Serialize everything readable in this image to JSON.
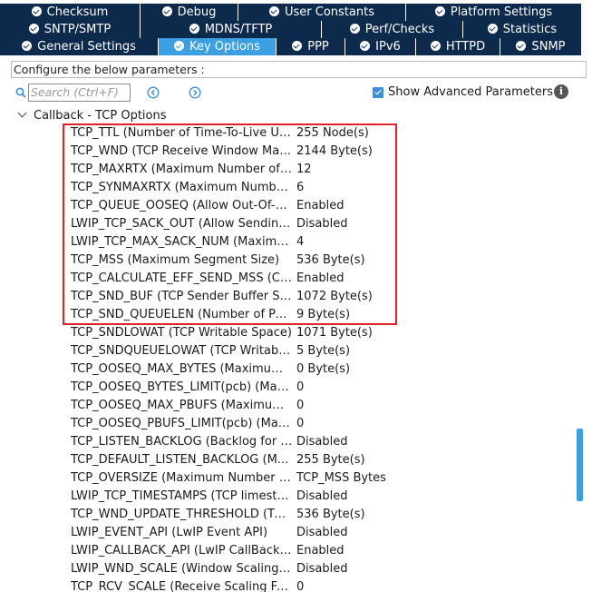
{
  "tabs": {
    "row1": [
      {
        "label": "Checksum"
      },
      {
        "label": "Debug"
      },
      {
        "label": "User Constants"
      },
      {
        "label": "Platform Settings"
      }
    ],
    "row2": [
      {
        "label": "SNTP/SMTP"
      },
      {
        "label": "MDNS/TFTP"
      },
      {
        "label": "Perf/Checks"
      },
      {
        "label": "Statistics"
      }
    ],
    "row3": [
      {
        "label": "General Settings"
      },
      {
        "label": "Key Options"
      },
      {
        "label": "PPP"
      },
      {
        "label": "IPv6"
      },
      {
        "label": "HTTPD"
      },
      {
        "label": "SNMP"
      }
    ],
    "active": "Key Options"
  },
  "config": {
    "label": "Configure the below parameters :"
  },
  "toolbar": {
    "search_placeholder": "Search (Ctrl+F)",
    "show_advanced_label": "Show Advanced Parameters",
    "show_advanced_checked": true,
    "info_glyph": "i"
  },
  "tree": {
    "group_label": "Callback - TCP Options",
    "params": [
      {
        "name": "TCP_TTL (Number of Time-To-Live Used ...",
        "value": "255 Node(s)"
      },
      {
        "name": "TCP_WND (TCP Receive Window Maxi...",
        "value": "2144 Byte(s)"
      },
      {
        "name": "TCP_MAXRTX (Maximum Number of Ret...",
        "value": "12"
      },
      {
        "name": "TCP_SYNMAXRTX (Maximum Number o...",
        "value": "6"
      },
      {
        "name": "TCP_QUEUE_OOSEQ (Allow Out-Of-Or...",
        "value": "Enabled"
      },
      {
        "name": "LWIP_TCP_SACK_OUT (Allow Sending ...",
        "value": "Disabled"
      },
      {
        "name": "LWIP_TCP_MAX_SACK_NUM (Maximu...",
        "value": "4"
      },
      {
        "name": "TCP_MSS (Maximum Segment Size)",
        "value": "536 Byte(s)"
      },
      {
        "name": "TCP_CALCULATE_EFF_SEND_MSS (Cal...",
        "value": "Enabled"
      },
      {
        "name": "TCP_SND_BUF (TCP Sender Buffer Spa...",
        "value": "1072 Byte(s)"
      },
      {
        "name": "TCP_SND_QUEUELEN (Number of Pac...",
        "value": "9 Byte(s)"
      },
      {
        "name": "TCP_SNDLOWAT (TCP Writable Space)",
        "value": "1071 Byte(s)"
      },
      {
        "name": "TCP_SNDQUEUELOWAT (TCP Writabl...",
        "value": "5 Byte(s)"
      },
      {
        "name": "TCP_OOSEQ_MAX_BYTES (Maximum ...",
        "value": "0 Byte(s)"
      },
      {
        "name": "TCP_OOSEQ_BYTES_LIMIT(pcb) (Maxi...",
        "value": "0"
      },
      {
        "name": "TCP_OOSEQ_MAX_PBUFS (Maximum ...",
        "value": "0"
      },
      {
        "name": "TCP_OOSEQ_PBUFS_LIMIT(pcb) (Maxi...",
        "value": "0"
      },
      {
        "name": "TCP_LISTEN_BACKLOG (Backlog for T...",
        "value": "Disabled"
      },
      {
        "name": "TCP_DEFAULT_LISTEN_BACKLOG (M...",
        "value": "255 Byte(s)"
      },
      {
        "name": "TCP_OVERSIZE (Maximum Number of ...",
        "value": "TCP_MSS Bytes"
      },
      {
        "name": "LWIP_TCP_TIMESTAMPS (TCP limesta...",
        "value": "Disabled"
      },
      {
        "name": "TCP_WND_UPDATE_THRESHOLD (TC...",
        "value": "536 Byte(s)"
      },
      {
        "name": "LWIP_EVENT_API (LwIP Event API)",
        "value": "Disabled"
      },
      {
        "name": "LWIP_CALLBACK_API (LwIP CallBack ...",
        "value": "Enabled"
      },
      {
        "name": "LWIP_WND_SCALE (Window Scaling S...",
        "value": "Disabled"
      },
      {
        "name": "TCP_RCV_SCALE (Receive Scaling Fa...",
        "value": "0"
      }
    ]
  },
  "colors": {
    "tab_bg": "#0d2a4c",
    "tab_active_bg": "#3c9fe0",
    "highlight_border": "#e0202a",
    "scrollbar_thumb": "#3c9fe0"
  },
  "icons": {
    "tab_icon": "check-circle-icon",
    "search": "search-icon",
    "prev": "arrow-left-circle-icon",
    "next": "arrow-right-circle-icon",
    "info": "info-icon",
    "group_toggle": "chevron-down-icon"
  }
}
